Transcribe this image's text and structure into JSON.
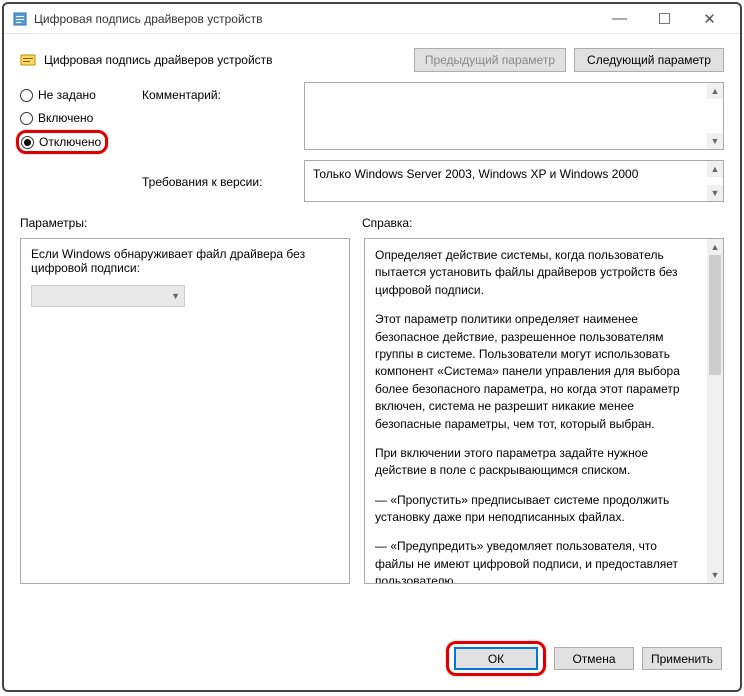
{
  "window": {
    "title": "Цифровая подпись драйверов устройств"
  },
  "header": {
    "title": "Цифровая подпись драйверов устройств",
    "prev": "Предыдущий параметр",
    "next": "Следующий параметр"
  },
  "radios": {
    "not_configured": "Не задано",
    "enabled": "Включено",
    "disabled": "Отключено"
  },
  "labels": {
    "comment": "Комментарий:",
    "requirements": "Требования к версии:",
    "parameters": "Параметры:",
    "help": "Справка:"
  },
  "requirements_text": "Только Windows Server 2003, Windows XP и Windows 2000",
  "param_text": "Если Windows обнаруживает файл драйвера без цифровой подписи:",
  "help": {
    "p1": "Определяет действие системы, когда пользователь пытается установить файлы драйверов устройств без цифровой подписи.",
    "p2": "Этот параметр политики определяет наименее безопасное действие, разрешенное пользователям группы в системе. Пользователи могут использовать компонент «Система» панели управления для выбора более безопасного параметра, но когда этот параметр включен, система не разрешит никакие менее безопасные параметры, чем тот, который выбран.",
    "p3": "При включении этого параметра задайте нужное действие в поле с раскрывающимся списком.",
    "p4": "— «Пропустить» предписывает системе продолжить установку даже при неподписанных файлах.",
    "p5": "— «Предупредить» уведомляет пользователя, что файлы не имеют цифровой подписи, и предоставляет пользователю"
  },
  "buttons": {
    "ok": "ОК",
    "cancel": "Отмена",
    "apply": "Применить"
  }
}
